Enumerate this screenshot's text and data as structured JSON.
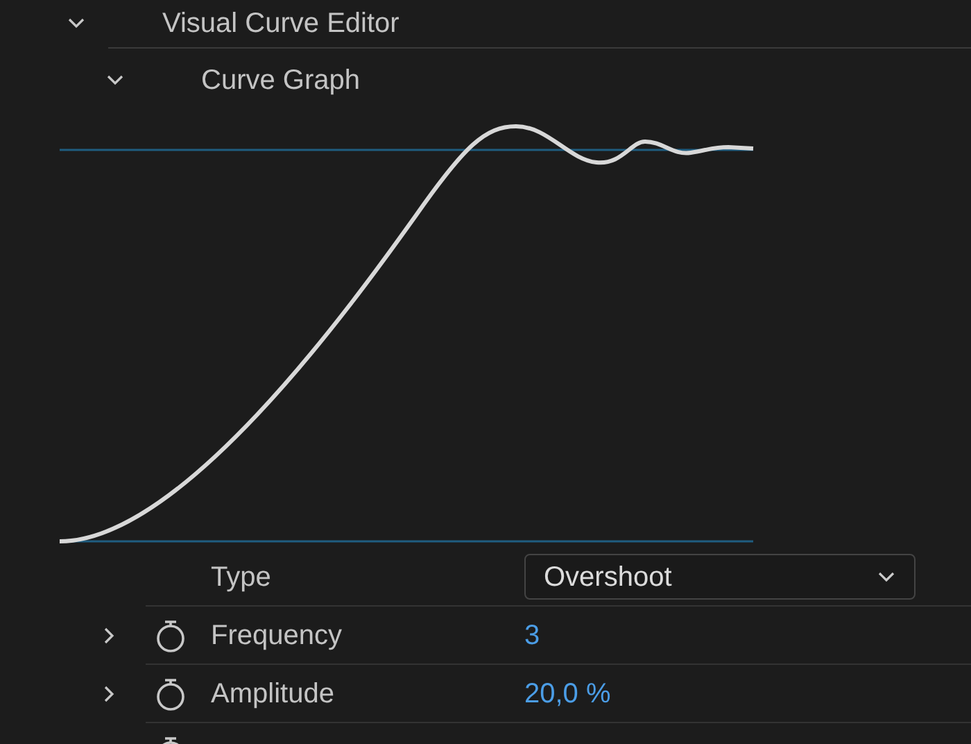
{
  "sections": [
    {
      "title": "Visual Curve Editor",
      "expanded": true
    },
    {
      "title": "Curve Graph",
      "expanded": true
    }
  ],
  "properties": [
    {
      "kind": "dropdown",
      "label": "Type",
      "value": "Overshoot"
    },
    {
      "kind": "value",
      "label": "Frequency",
      "value": "3",
      "expanded": false
    },
    {
      "kind": "value",
      "label": "Amplitude",
      "value": "20,0 %",
      "expanded": false
    },
    {
      "kind": "cut"
    }
  ]
}
